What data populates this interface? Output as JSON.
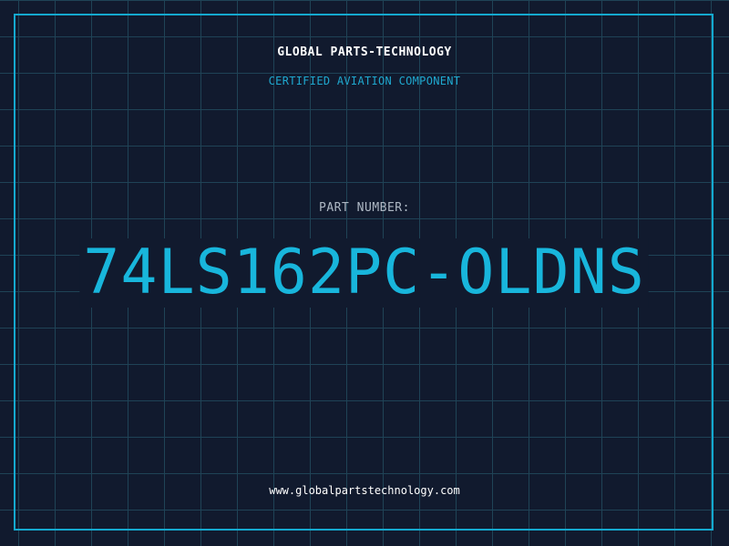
{
  "header": {
    "company": "GLOBAL PARTS-TECHNOLOGY",
    "subtitle": "CERTIFIED AVIATION COMPONENT"
  },
  "part": {
    "label": "PART NUMBER:",
    "number": "74LS162PC-OLDNS"
  },
  "footer": {
    "website": "www.globalpartstechnology.com"
  },
  "colors": {
    "background": "#111a2e",
    "grid": "#1f4356",
    "accent": "#14a9cf",
    "part_number": "#18b6dc",
    "text_primary": "#ffffff",
    "text_muted": "#aeb8c4"
  }
}
